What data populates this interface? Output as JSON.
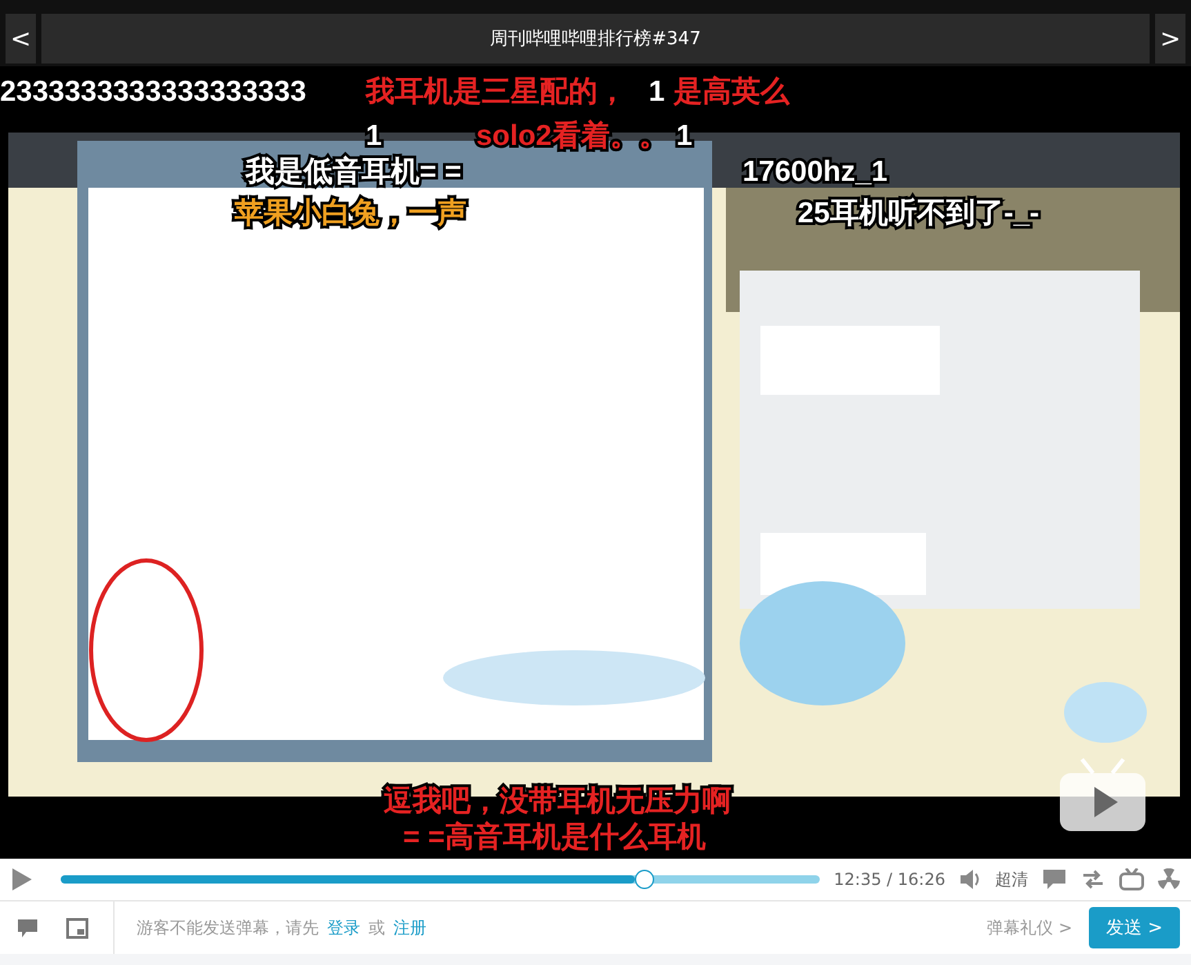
{
  "header": {
    "prev": "<",
    "title": "周刊哔哩哔哩排行榜#347",
    "next": ">"
  },
  "danmaku": [
    {
      "text": "2333333333333333333",
      "color": "#ffffff"
    },
    {
      "text": "我耳机是三星配的，",
      "color": "#e52222"
    },
    {
      "text": "1",
      "color": "#ffffff"
    },
    {
      "text": "是高英么",
      "color": "#e52222"
    },
    {
      "text": "1",
      "color": "#ffffff"
    },
    {
      "text": "solo2看着。。",
      "color": "#e52222"
    },
    {
      "text": "1",
      "color": "#ffffff"
    },
    {
      "text": "我是低音耳机= =",
      "color": "#ffffff"
    },
    {
      "text": "苹果小白兔，一声",
      "color": "#f0a020"
    },
    {
      "text": "17600hz_1",
      "color": "#ffffff"
    },
    {
      "text": "25耳机听不到了-_-",
      "color": "#ffffff"
    },
    {
      "text": "逗我吧，没带耳机无压力啊",
      "color": "#e52222"
    },
    {
      "text": "= =高音耳机是什么耳机",
      "color": "#e52222"
    }
  ],
  "controls": {
    "level": 0.757,
    "time": "12:35 / 16:26",
    "quality": "超清"
  },
  "comment_bar": {
    "notice": "游客不能发送弹幕，请先",
    "login": "登录",
    "or": "或",
    "register": "注册",
    "etiquette": "弹幕礼仪 >",
    "send": "发送 >"
  }
}
